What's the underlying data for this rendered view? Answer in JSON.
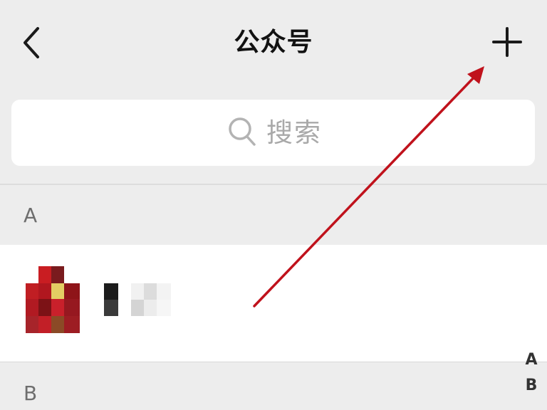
{
  "nav": {
    "title": "公众号",
    "back_icon": "chevron-left-icon",
    "add_icon": "plus-icon"
  },
  "search": {
    "placeholder": "搜索",
    "icon": "search-icon"
  },
  "sections": [
    {
      "header": "A",
      "items": [
        {
          "name": "",
          "avatar": "pixelated-red-avatar"
        }
      ]
    },
    {
      "header": "B",
      "items": []
    }
  ],
  "index_bar": {
    "letters": [
      "A",
      "B"
    ]
  },
  "colors": {
    "page_background": "#ededed",
    "card_background": "#ffffff",
    "annotation_arrow": "#c0121c",
    "placeholder_text": "#a9a9a9"
  }
}
